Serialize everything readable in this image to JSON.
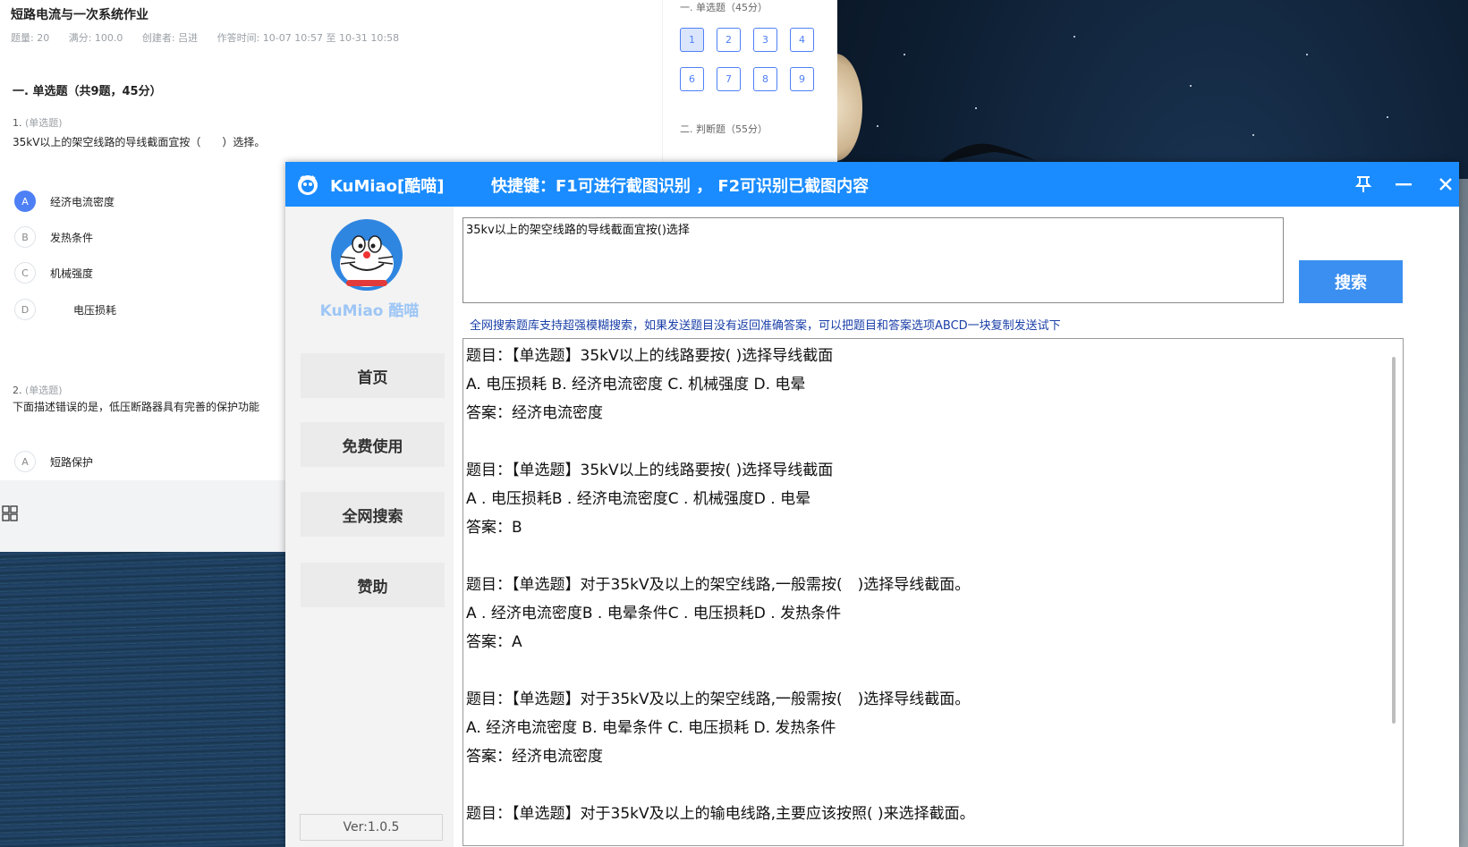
{
  "quiz": {
    "title": "短路电流与一次系统作业",
    "meta": {
      "count": "题量: 20",
      "full": "满分: 100.0",
      "creator": "创建者: 吕进",
      "time": "作答时间: 10-07 10:57  至  10-31 10:58"
    },
    "section": "一. 单选题（共9题，45分）",
    "q1": {
      "num": "1.",
      "tag": "(单选题)",
      "text": "35kV以上的架空线路的导线截面宜按（　　）选择。",
      "options": [
        {
          "letter": "A",
          "label": "经济电流密度"
        },
        {
          "letter": "B",
          "label": "发热条件"
        },
        {
          "letter": "C",
          "label": "机械强度"
        },
        {
          "letter": "D",
          "label": "电压损耗"
        }
      ]
    },
    "q2": {
      "num": "2.",
      "tag": "(单选题)",
      "text": "下面描述错误的是，低压断路器具有完善的保护功能",
      "options": [
        {
          "letter": "A",
          "label": "短路保护"
        }
      ]
    },
    "side": {
      "sec1": "一. 单选题（45分）",
      "sec2": "二. 判断题（55分）",
      "row1": [
        "1",
        "2",
        "3",
        "4"
      ],
      "row2": [
        "6",
        "7",
        "8",
        "9"
      ]
    }
  },
  "app": {
    "name": "KuMiao[酷喵]",
    "hint": "快捷键：F1可进行截图识别  ，  F2可识别已截图内容",
    "logo_text": "KuMiao 酷喵",
    "nav": [
      "首页",
      "免费使用",
      "全网搜索",
      "赞助"
    ],
    "version": "Ver:1.0.5",
    "query": "35kv以上的架空线路的导线截面宜按()选择",
    "search_label": "搜索",
    "notice": "全网搜索题库支持超强模糊搜索，如果发送题目没有返回准确答案，可以把题目和答案选项ABCD一块复制发送试下",
    "results": [
      "题目：【单选题】35kV以上的线路要按( )选择导线截面",
      "A. 电压损耗 B. 经济电流密度 C. 机械强度 D. 电晕",
      "答案：经济电流密度",
      "",
      "题目：【单选题】35kV以上的线路要按( )选择导线截面",
      "A . 电压损耗B . 经济电流密度C . 机械强度D . 电晕",
      "答案：B",
      "",
      "题目：【单选题】对于35kV及以上的架空线路,一般需按(　)选择导线截面。",
      "A . 经济电流密度B . 电晕条件C . 电压损耗D . 发热条件",
      "答案：A",
      "",
      "题目：【单选题】对于35kV及以上的架空线路,一般需按(　)选择导线截面。",
      "A. 经济电流密度 B. 电晕条件 C. 电压损耗 D. 发热条件",
      "答案：经济电流密度",
      "",
      "题目：【单选题】对于35kV及以上的输电线路,主要应该按照( )来选择截面。"
    ],
    "colors": {
      "titlebar": "#1a8cff",
      "button": "#3b8ff0",
      "notice": "#1a3fa8"
    }
  }
}
